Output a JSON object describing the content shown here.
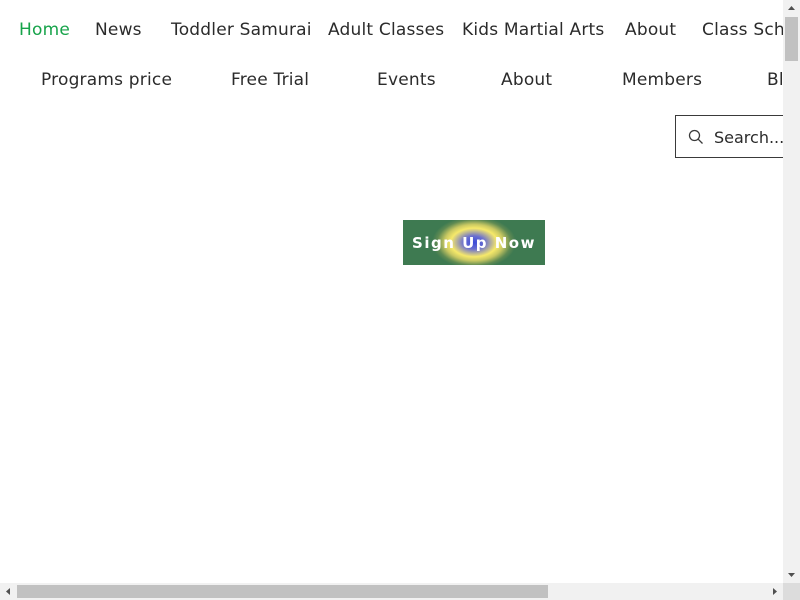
{
  "nav": {
    "primary": [
      {
        "label": "Home",
        "active": true
      },
      {
        "label": "News"
      },
      {
        "label": "Toddler Samurai"
      },
      {
        "label": "Adult Classes"
      },
      {
        "label": "Kids Martial Arts"
      },
      {
        "label": "About"
      },
      {
        "label": "Class Sche"
      }
    ],
    "secondary": [
      {
        "label": "Programs price"
      },
      {
        "label": "Free Trial"
      },
      {
        "label": "Events"
      },
      {
        "label": "About"
      },
      {
        "label": "Members"
      },
      {
        "label": "Bl"
      }
    ]
  },
  "search": {
    "placeholder": "Search..."
  },
  "cta": {
    "label": "Sign Up Now"
  },
  "colors": {
    "active_link": "#17a34a",
    "cta_center": "#3b4bd8",
    "cta_ring": "#f6e96a",
    "cta_edge": "#3e7a51"
  }
}
